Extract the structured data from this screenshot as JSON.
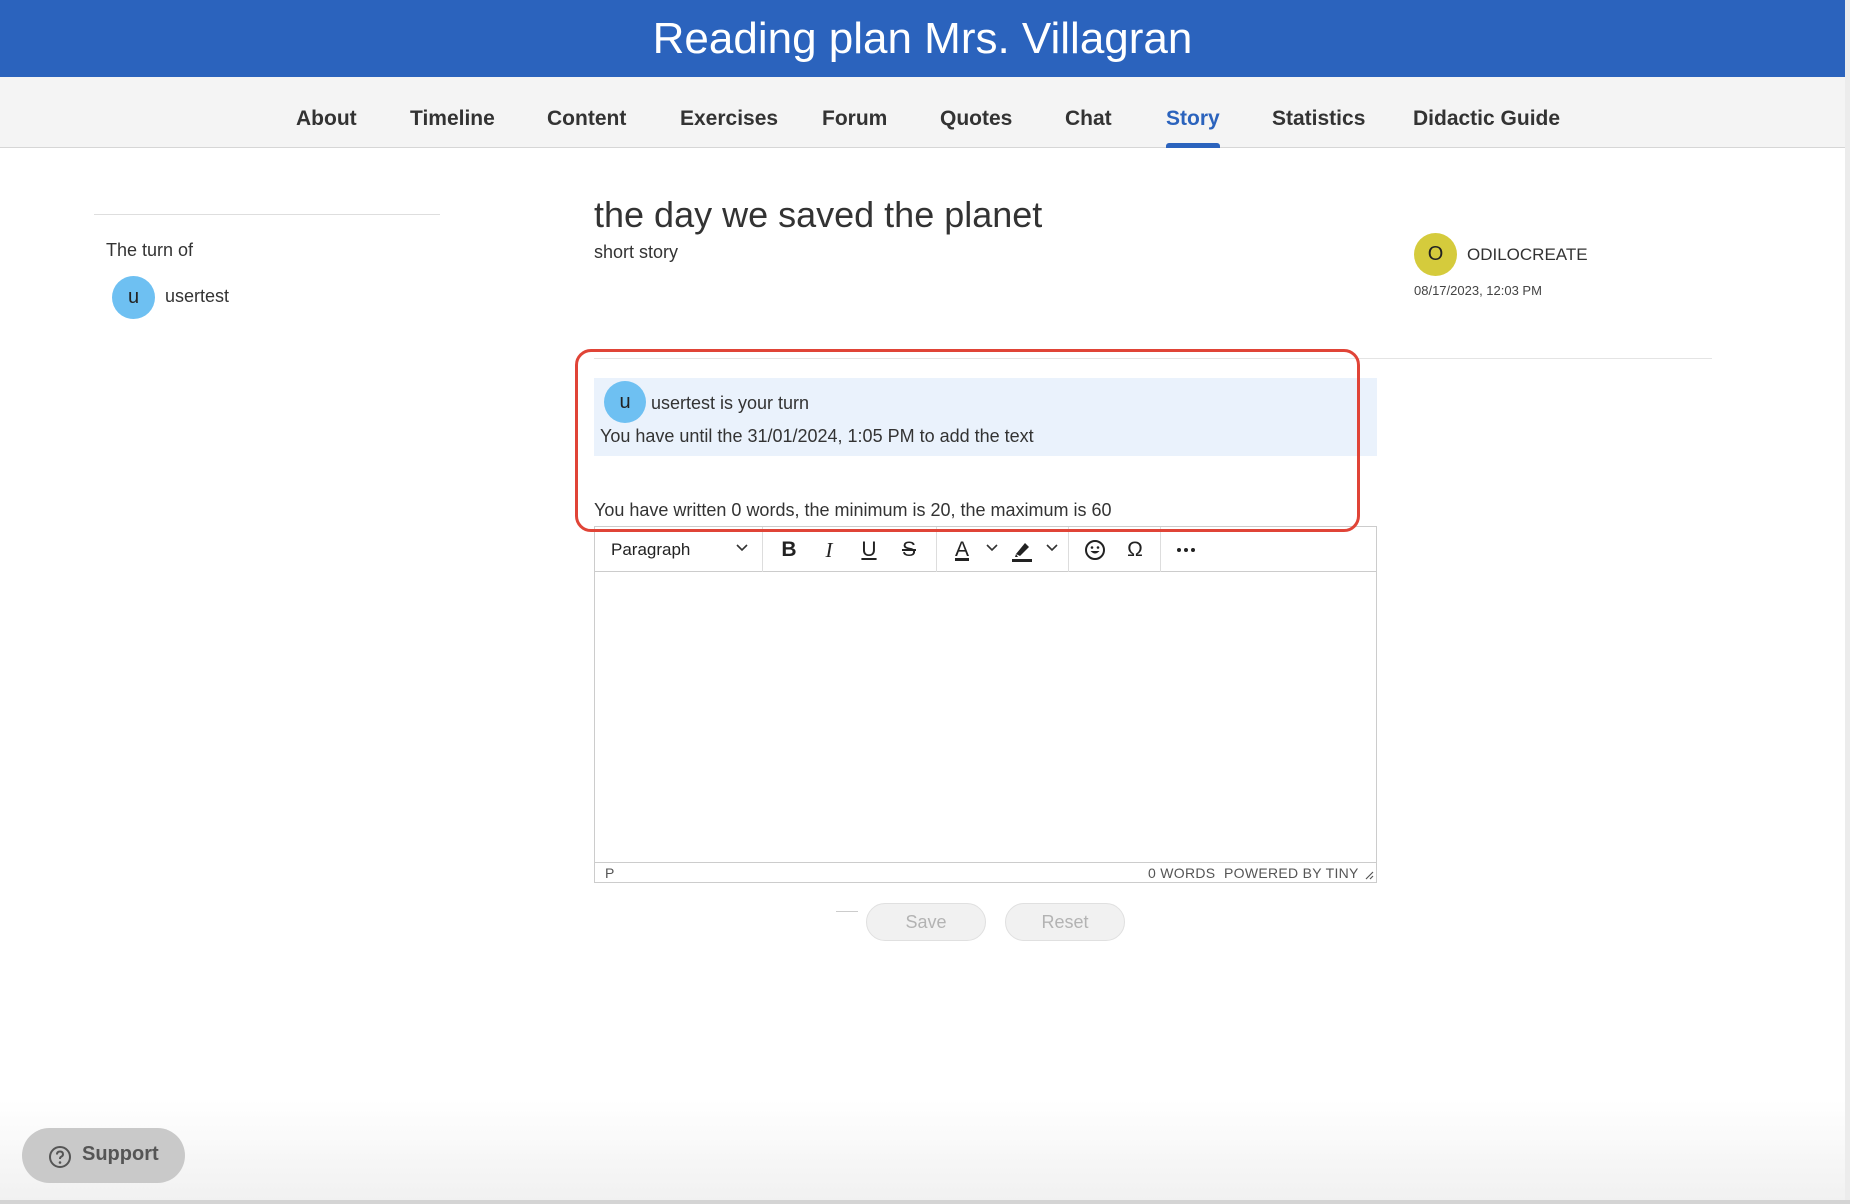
{
  "header": {
    "title": "Reading plan Mrs. Villagran"
  },
  "nav": {
    "items": [
      {
        "label": "About"
      },
      {
        "label": "Timeline"
      },
      {
        "label": "Content"
      },
      {
        "label": "Exercises"
      },
      {
        "label": "Forum"
      },
      {
        "label": "Quotes"
      },
      {
        "label": "Chat"
      },
      {
        "label": "Story",
        "active": true
      },
      {
        "label": "Statistics"
      },
      {
        "label": "Didactic Guide"
      }
    ]
  },
  "sidebar": {
    "turn_label": "The turn of",
    "user": {
      "initial": "u",
      "name": "usertest"
    }
  },
  "story": {
    "title": "the day we saved the planet",
    "subtitle": "short story",
    "author": {
      "initial": "O",
      "name": "ODILOCREATE",
      "date": "08/17/2023, 12:03 PM"
    }
  },
  "turn": {
    "initial": "u",
    "message": "usertest is your turn",
    "deadline": "You have until the 31/01/2024, 1:05 PM to add the text",
    "word_count_text": "You have written 0 words, the minimum is 20, the maximum is 60"
  },
  "editor": {
    "format_select": "Paragraph",
    "toolbar_icons": [
      "bold-icon",
      "italic-icon",
      "underline-icon",
      "strikethrough-icon",
      "text-color-icon",
      "highlight-icon",
      "emoji-icon",
      "special-character-icon",
      "more-icon"
    ],
    "status_path": "P",
    "status_words": "0 WORDS",
    "powered_by": "POWERED BY TINY"
  },
  "actions": {
    "save_label": "Save",
    "reset_label": "Reset"
  },
  "support": {
    "label": "Support"
  },
  "colors": {
    "brand": "#2b63bd",
    "highlight_border": "#e04437",
    "turn_box_bg": "#eaf2fc",
    "user_avatar": "#6ec0f2",
    "author_avatar": "#d5cb3c"
  }
}
